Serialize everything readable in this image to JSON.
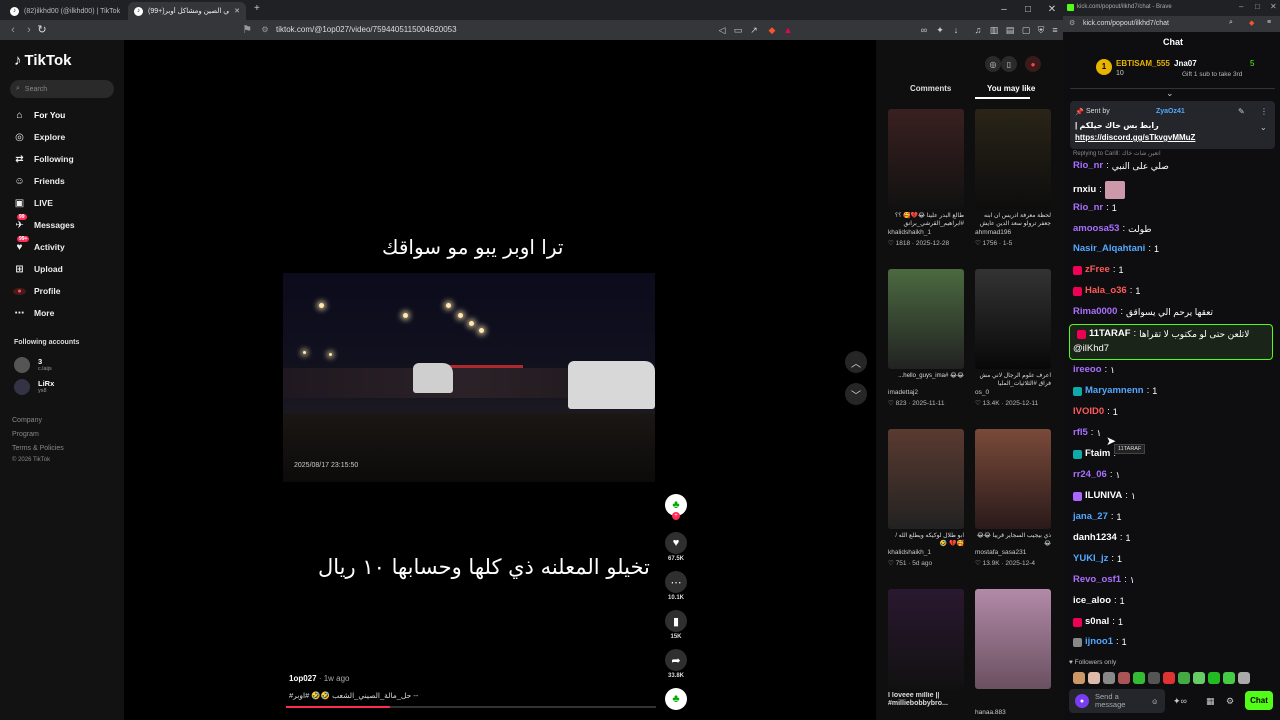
{
  "browser": {
    "tabs": [
      {
        "title": "(82)ilkhd00 (@ilkhd00) | TikTok"
      },
      {
        "title": "(99+)الناس في الصين ومشاكل أوبر | TikTok"
      }
    ],
    "new_tab": "+",
    "url": "tiktok.com/@1op027/video/7594405115004620053"
  },
  "tiktok": {
    "logo": "TikTok",
    "search_placeholder": "Search",
    "nav": [
      {
        "label": "For You",
        "icon": "home-icon",
        "glyph": "⌂"
      },
      {
        "label": "Explore",
        "icon": "compass-icon",
        "glyph": "◎"
      },
      {
        "label": "Following",
        "icon": "following-icon",
        "glyph": "⇄"
      },
      {
        "label": "Friends",
        "icon": "friends-icon",
        "glyph": "☺"
      },
      {
        "label": "LIVE",
        "icon": "live-icon",
        "glyph": "▣"
      },
      {
        "label": "Messages",
        "icon": "messages-icon",
        "glyph": "✈",
        "badge": "99"
      },
      {
        "label": "Activity",
        "icon": "activity-icon",
        "glyph": "♥",
        "badge": "99+"
      },
      {
        "label": "Upload",
        "icon": "upload-icon",
        "glyph": "⊞"
      },
      {
        "label": "Profile",
        "icon": "profile-icon",
        "glyph": "●"
      },
      {
        "label": "More",
        "icon": "more-icon",
        "glyph": "⋯"
      }
    ],
    "following_header": "Following accounts",
    "following": [
      {
        "name": "3",
        "handle": "c.laijs"
      },
      {
        "name": "LiRx",
        "handle": "yx8"
      }
    ],
    "footer": [
      "Company",
      "Program",
      "Terms & Policies",
      "© 2026 TikTok"
    ],
    "video": {
      "top_caption": "ترا اوبر يبو مو سواقك",
      "bottom_caption": "تخيلو المعلنه ذي كلها وحسابها ١٠ ريال",
      "timestamp": "2025/08/17 23:15:50",
      "author": "1op027",
      "age": "· 1w ago",
      "description": "#حل_مالة_الصيني_الشعب 🤣🤣 #اوبر --",
      "progress": 0.28,
      "likes": "67.5K",
      "comments": "10.1K",
      "saves": "15K",
      "shares": "33.8K"
    },
    "related_tabs": [
      "Comments",
      "You may like"
    ],
    "related": [
      {
        "title": "طالع البدر علينا 😂💔🥰 ؟؟ #ابراهيم_القرشي_برانق",
        "user": "khalidshaikh_1",
        "stats": "♡ 1818 · 2025-12-28",
        "bg1": "#3a2020",
        "bg2": "#111"
      },
      {
        "title": "لحظة معرفة ادريس ان ابنه جعفر ترولو سعد الدين عايش",
        "user": "ahmmad196",
        "stats": "♡ 1756 · 1-5",
        "bg1": "#2a2418",
        "bg2": "#0d0d0d"
      },
      {
        "title": "😂😂 #hello_guys_ima...",
        "user": "imadettaj2",
        "stats": "♡ 823 · 2025-11-11",
        "bg1": "#4b6a40",
        "bg2": "#222"
      },
      {
        "title": "اعرف علوم الرجال لاني مش فراق #الثلاثيات_المليا",
        "user": "os_0",
        "stats": "♡ 13.4K · 2025-12-11",
        "bg1": "#333",
        "bg2": "#080808"
      },
      {
        "title": "ابو طلال لوكيكه ويطلع الله / 🥰💔 🤣",
        "user": "khalidshaikh_1",
        "stats": "♡ 751 · 5d ago",
        "bg1": "#5a3a30",
        "bg2": "#222"
      },
      {
        "title": "ذي بيجيب السجاير قريبا 😂😂😂",
        "user": "mostafa_sasa231",
        "stats": "♡ 13.9K · 2025-12-4",
        "bg1": "#7a4a3a",
        "bg2": "#2a1a1a"
      },
      {
        "title": "I loveee millie || #milliebobbybro...",
        "user": "",
        "stats": "",
        "bg1": "#2a1830",
        "bg2": "#111"
      },
      {
        "title": "",
        "user": "hanaa.883",
        "stats": "",
        "bg1": "#b28aa8",
        "bg2": "#6a5060"
      }
    ]
  },
  "kick": {
    "window_title": "kick.com/popout/ilkhd7/chat - Brave",
    "url": "kick.com/popout/ilkhd7/chat",
    "header": "Chat",
    "leader1": {
      "name": "EBTISAM_555",
      "count": "10"
    },
    "leader2": {
      "name": "Jna07",
      "count": "5",
      "note": "Gift 1 sub to take 3rd"
    },
    "pinned": {
      "sent_by": "Sent by",
      "user": "ZyaOz41",
      "text": "رابط بس خاك حيلكم |",
      "link": "https://discord.gg/sTkvgvMMuZ"
    },
    "reply_note": "Replying to Carill: اتعين شات خاك",
    "messages": [
      {
        "user": "Rio_nr",
        "color": "#a970ff",
        "text": "صلي على النبي"
      },
      {
        "user": "rnxiu",
        "color": "#ffffff",
        "text": ""
      },
      {
        "user": "Rio_nr",
        "color": "#a970ff",
        "text": "1"
      },
      {
        "user": "amoosa53",
        "color": "#a970ff",
        "text": "طولت"
      },
      {
        "user": "Nasir_Alqahtani",
        "color": "#53a8ff",
        "text": "1"
      },
      {
        "user": "zFree",
        "color": "#ff5a5a",
        "text": "1"
      },
      {
        "user": "Hala_o36",
        "color": "#ff5a5a",
        "text": "1"
      },
      {
        "user": "Rima0000",
        "color": "#a970ff",
        "text": "تعقها يرحم الي يسواقق"
      },
      {
        "user": "11TARAF",
        "color": "#ffffff",
        "text": "لاتلعن حتى لو مكتوب لا تقراها",
        "text2": "@ilKhd7"
      },
      {
        "user": "ireeoo",
        "color": "#a970ff",
        "text": "١"
      },
      {
        "user": "Maryamnenn",
        "color": "#53a8ff",
        "text": "1"
      },
      {
        "user": "IVOID0",
        "color": "#ff5a5a",
        "text": "1"
      },
      {
        "user": "rfl5",
        "color": "#a970ff",
        "text": "١"
      },
      {
        "user": "Ftaim",
        "color": "#ffffff",
        "text": ""
      },
      {
        "user": "rr24_06",
        "color": "#a970ff",
        "text": "١"
      },
      {
        "user": "ILUNIVA",
        "color": "#ffffff",
        "text": "١"
      },
      {
        "user": "jana_27",
        "color": "#53a8ff",
        "text": "1"
      },
      {
        "user": "danh1234",
        "color": "#ffffff",
        "text": "1"
      },
      {
        "user": "YUKI_jz",
        "color": "#53a8ff",
        "text": "1"
      },
      {
        "user": "Revo_osf1",
        "color": "#a970ff",
        "text": "١"
      },
      {
        "user": "ice_aloo",
        "color": "#ffffff",
        "text": "1"
      },
      {
        "user": "s0nal",
        "color": "#ffffff",
        "text": "1"
      },
      {
        "user": "ijnoo1",
        "color": "#53a8ff",
        "text": "1"
      }
    ],
    "tooltip": "11TARAF",
    "followers_only": "Followers only",
    "input_placeholder": "Send a message",
    "chat_button": "Chat",
    "accent": "#53fc18"
  }
}
